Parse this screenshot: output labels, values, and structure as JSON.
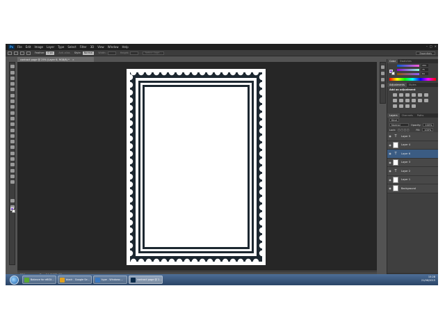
{
  "app": {
    "logo": "Ps"
  },
  "menu": {
    "items": [
      "File",
      "Edit",
      "Image",
      "Layer",
      "Type",
      "Select",
      "Filter",
      "3D",
      "View",
      "Window",
      "Help"
    ]
  },
  "options": {
    "feather_label": "Feather:",
    "feather_value": "0 px",
    "antialias_label": "Anti-alias",
    "style_label": "Style:",
    "style_value": "Normal",
    "width_label": "Width:",
    "height_label": "Height:",
    "refine_label": "Refine Edge...",
    "workspace": "Essentials"
  },
  "document": {
    "tab_title": "contract page @ 25% (Layer 6, RGB/8) *",
    "zoom": "25%",
    "doc_size": "Doc: 24.9M/32.4M"
  },
  "colors": {
    "foreground": "#8f5bd8",
    "background": "#ffffff",
    "frame": "#1c2730"
  },
  "color_panel": {
    "tabs": [
      "Color",
      "Swatches"
    ],
    "values": [
      "184",
      "75",
      "84"
    ]
  },
  "adjustments_panel": {
    "tabs": [
      "Adjustments",
      "Styles"
    ],
    "title": "Add an adjustment"
  },
  "layers_panel": {
    "tabs": [
      "Layers",
      "Channels",
      "Paths"
    ],
    "kind_label": "Kind",
    "blend_mode": "Normal",
    "opacity_label": "Opacity:",
    "opacity_value": "100%",
    "lock_label": "Lock:",
    "fill_label": "Fill:",
    "fill_value": "100%",
    "layers": [
      {
        "name": "Layer 5",
        "kind": "type",
        "selected": false
      },
      {
        "name": "Layer 4",
        "kind": "pixel",
        "selected": false
      },
      {
        "name": "Layer 6",
        "kind": "type",
        "selected": true
      },
      {
        "name": "Layer 3",
        "kind": "pixel",
        "selected": false
      },
      {
        "name": "Layer 2",
        "kind": "type",
        "selected": false
      },
      {
        "name": "Layer 1",
        "kind": "pixel",
        "selected": false
      },
      {
        "name": "Background",
        "kind": "pixel",
        "selected": false
      }
    ]
  },
  "taskbar": {
    "tasks": [
      {
        "label": "Balance for eBOX...",
        "icon_color": "#5aa832",
        "active": false
      },
      {
        "label": "black - Google Se...",
        "icon_color": "#e0a020",
        "active": false
      },
      {
        "label": "type - Windows ...",
        "icon_color": "#3a78c0",
        "active": false
      },
      {
        "label": "contract page @ 2...",
        "icon_color": "#0b2b4a",
        "active": true
      }
    ],
    "time": "15:28",
    "date": "21/06/2015"
  }
}
